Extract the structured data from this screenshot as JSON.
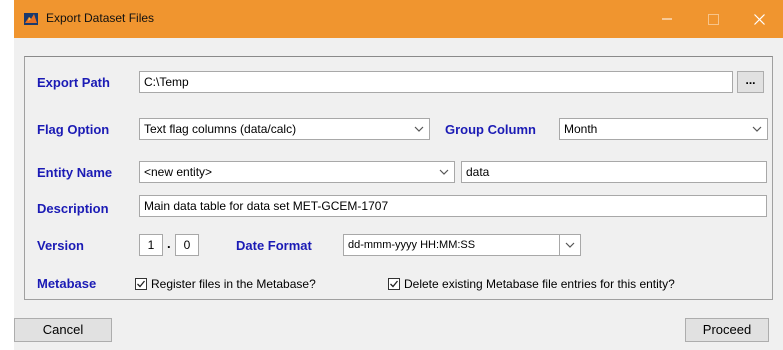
{
  "window": {
    "title": "Export Dataset Files"
  },
  "export_path": {
    "label": "Export Path",
    "value": "C:\\Temp",
    "browse_label": "..."
  },
  "flag_option": {
    "label": "Flag Option",
    "selected": "Text flag columns (data/calc)"
  },
  "group_column": {
    "label": "Group Column",
    "selected": "Month"
  },
  "entity_name": {
    "label": "Entity Name",
    "selected": "<new entity>",
    "value": "data"
  },
  "description": {
    "label": "Description",
    "value": "Main data table for data set MET-GCEM-1707"
  },
  "version": {
    "label": "Version",
    "major": "1",
    "separator": ".",
    "minor": "0"
  },
  "date_format": {
    "label": "Date Format",
    "selected": "dd-mmm-yyyy HH:MM:SS"
  },
  "metabase": {
    "label": "Metabase",
    "register": {
      "label": "Register files in the Metabase?",
      "checked": true
    },
    "delete_existing": {
      "label": "Delete existing Metabase file entries for this entity?",
      "checked": true
    }
  },
  "footer": {
    "cancel_label": "Cancel",
    "proceed_label": "Proceed"
  },
  "colors": {
    "titlebar": "#f0952f",
    "label_text": "#1b1bb5",
    "background": "#f0f0f0"
  }
}
